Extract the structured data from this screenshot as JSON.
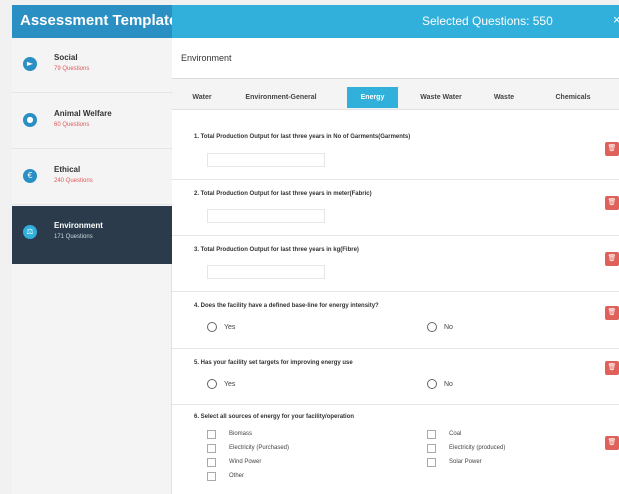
{
  "header": {
    "title": "Assessment Template",
    "selected": "Selected Questions: 550",
    "close": "×"
  },
  "sidebar": {
    "items": [
      {
        "title": "Social",
        "count": "79 Questions",
        "icon": "arrow-right-icon",
        "glyph": "►"
      },
      {
        "title": "Animal Welfare",
        "count": "60 Questions",
        "icon": "user-icon",
        "glyph": "●"
      },
      {
        "title": "Ethical",
        "count": "240 Questions",
        "icon": "euro-icon",
        "glyph": "€"
      },
      {
        "title": "Environment",
        "count": "171 Questions",
        "icon": "scale-icon",
        "glyph": "⚖"
      }
    ]
  },
  "main": {
    "title": "Environment",
    "tabs": [
      "Water",
      "Environment-General",
      "Energy",
      "Waste Water",
      "Waste",
      "Chemicals"
    ],
    "active_tab": "Energy",
    "questions": [
      {
        "text": "1. Total Production Output for last three years in No of Garments(Garments)",
        "type": "input"
      },
      {
        "text": "2. Total Production Output for last three years in meter(Fabric)",
        "type": "input"
      },
      {
        "text": "3. Total Production Output for last three years in kg(Fibre)",
        "type": "input"
      },
      {
        "text": "4. Does the facility have a defined base-line for energy intensity?",
        "type": "radio",
        "options": [
          "Yes",
          "No"
        ]
      },
      {
        "text": "5. Has your facility set targets for improving energy use",
        "type": "radio",
        "options": [
          "Yes",
          "No"
        ]
      },
      {
        "text": "6. Select all sources of energy for your facility/operation",
        "type": "checkbox",
        "options": [
          "Biomass",
          "Coal",
          "Electricity (Purchased)",
          "Electricity (produced)",
          "Wind Power",
          "Solar Power",
          "Other"
        ]
      }
    ],
    "delete_glyph": "🗑"
  },
  "colors": {
    "header_dark": "#2a8fc3",
    "header_light": "#31b0dc",
    "sidebar_active": "#2b3b4b",
    "delete": "#e0605a",
    "count_text": "#e05a5a"
  }
}
